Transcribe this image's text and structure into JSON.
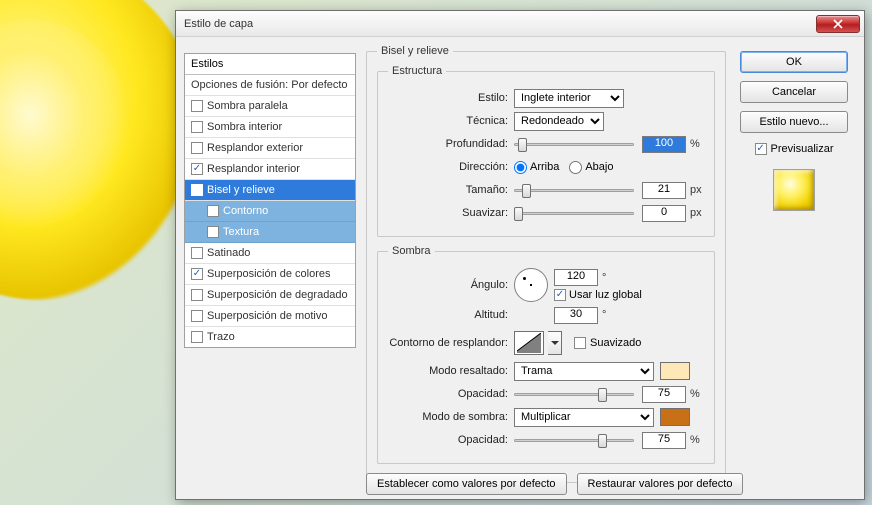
{
  "window": {
    "title": "Estilo de capa"
  },
  "sidebar": {
    "header": "Estilos",
    "blending": "Opciones de fusión: Por defecto",
    "items": [
      {
        "label": "Sombra paralela",
        "checked": false
      },
      {
        "label": "Sombra interior",
        "checked": false
      },
      {
        "label": "Resplandor exterior",
        "checked": false
      },
      {
        "label": "Resplandor interior",
        "checked": true
      },
      {
        "label": "Bisel y relieve",
        "checked": true,
        "selected": true
      },
      {
        "label": "Contorno",
        "checked": false,
        "sub": true
      },
      {
        "label": "Textura",
        "checked": false,
        "sub": true
      },
      {
        "label": "Satinado",
        "checked": false
      },
      {
        "label": "Superposición de colores",
        "checked": true
      },
      {
        "label": "Superposición de degradado",
        "checked": false
      },
      {
        "label": "Superposición de motivo",
        "checked": false
      },
      {
        "label": "Trazo",
        "checked": false
      }
    ]
  },
  "panel": {
    "title": "Bisel y relieve",
    "structure": {
      "legend": "Estructura",
      "style_lbl": "Estilo:",
      "style_val": "Inglete interior",
      "technique_lbl": "Técnica:",
      "technique_val": "Redondeado",
      "depth_lbl": "Profundidad:",
      "depth_val": "100",
      "depth_unit": "%",
      "direction_lbl": "Dirección:",
      "dir_up": "Arriba",
      "dir_down": "Abajo",
      "size_lbl": "Tamaño:",
      "size_val": "21",
      "size_unit": "px",
      "soften_lbl": "Suavizar:",
      "soften_val": "0",
      "soften_unit": "px"
    },
    "shading": {
      "legend": "Sombra",
      "angle_lbl": "Ángulo:",
      "angle_val": "120",
      "angle_unit": "°",
      "global_light": "Usar luz global",
      "altitude_lbl": "Altitud:",
      "altitude_val": "30",
      "altitude_unit": "°",
      "gloss_lbl": "Contorno de resplandor:",
      "antialias": "Suavizado",
      "highlight_mode_lbl": "Modo resaltado:",
      "highlight_mode_val": "Trama",
      "highlight_color": "#ffe8b8",
      "opacity_lbl": "Opacidad:",
      "highlight_opacity": "75",
      "shadow_mode_lbl": "Modo de sombra:",
      "shadow_mode_val": "Multiplicar",
      "shadow_color": "#c87018",
      "shadow_opacity": "75",
      "pct": "%"
    },
    "buttons": {
      "make_default": "Establecer como valores por defecto",
      "reset_default": "Restaurar valores por defecto"
    }
  },
  "right": {
    "ok": "OK",
    "cancel": "Cancelar",
    "new_style": "Estilo nuevo...",
    "preview": "Previsualizar"
  }
}
